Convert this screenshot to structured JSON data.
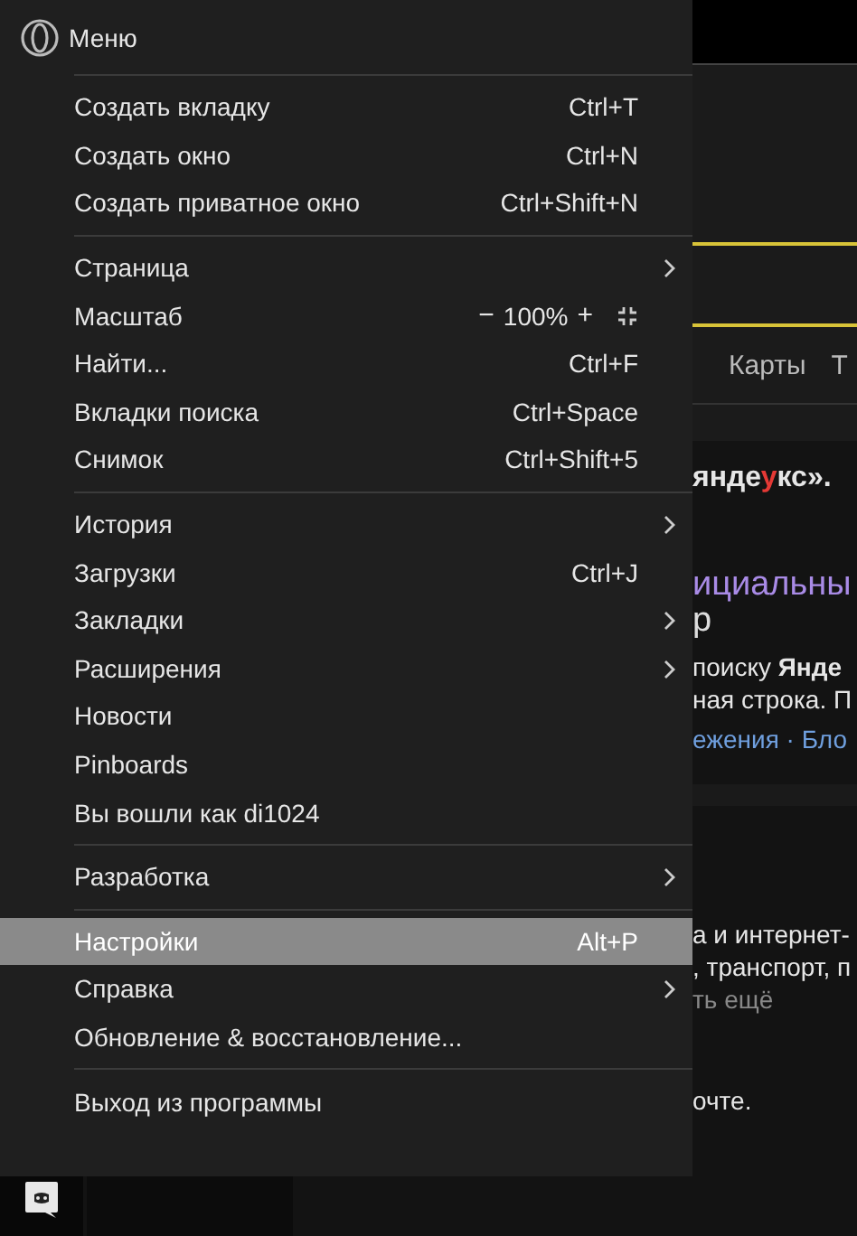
{
  "menu": {
    "title": "Меню",
    "groups": [
      [
        {
          "kind": "item",
          "label": "Создать вкладку",
          "shortcut": "Ctrl+T",
          "submenu": false,
          "selected": false
        },
        {
          "kind": "item",
          "label": "Создать окно",
          "shortcut": "Ctrl+N",
          "submenu": false,
          "selected": false
        },
        {
          "kind": "item",
          "label": "Создать приватное окно",
          "shortcut": "Ctrl+Shift+N",
          "submenu": false,
          "selected": false
        }
      ],
      [
        {
          "kind": "item",
          "label": "Страница",
          "submenu": true,
          "selected": false
        },
        {
          "kind": "zoom",
          "label": "Масштаб",
          "minus": "−",
          "value": "100%",
          "plus": "+",
          "submenu": false,
          "selected": false
        },
        {
          "kind": "item",
          "label": "Найти...",
          "shortcut": "Ctrl+F",
          "submenu": false,
          "selected": false
        },
        {
          "kind": "item",
          "label": "Вкладки поиска",
          "shortcut": "Ctrl+Space",
          "submenu": false,
          "selected": false
        },
        {
          "kind": "item",
          "label": "Снимок",
          "shortcut": "Ctrl+Shift+5",
          "submenu": false,
          "selected": false
        }
      ],
      [
        {
          "kind": "item",
          "label": "История",
          "submenu": true,
          "selected": false
        },
        {
          "kind": "item",
          "label": "Загрузки",
          "shortcut": "Ctrl+J",
          "submenu": false,
          "selected": false
        },
        {
          "kind": "item",
          "label": "Закладки",
          "submenu": true,
          "selected": false
        },
        {
          "kind": "item",
          "label": "Расширения",
          "submenu": true,
          "selected": false
        },
        {
          "kind": "item",
          "label": "Новости",
          "submenu": false,
          "selected": false
        },
        {
          "kind": "item",
          "label": "Pinboards",
          "submenu": false,
          "selected": false
        },
        {
          "kind": "item",
          "label": "Вы вошли как di1024",
          "submenu": false,
          "selected": false
        }
      ],
      [
        {
          "kind": "item",
          "label": "Разработка",
          "submenu": true,
          "selected": false
        }
      ],
      [
        {
          "kind": "item",
          "label": "Настройки",
          "shortcut": "Alt+P",
          "submenu": false,
          "selected": true
        },
        {
          "kind": "item",
          "label": "Справка",
          "submenu": true,
          "selected": false
        },
        {
          "kind": "item",
          "label": "Обновление & восстановление...",
          "submenu": false,
          "selected": false
        }
      ],
      [
        {
          "kind": "item",
          "label": "Выход из программы",
          "submenu": false,
          "selected": false
        }
      ]
    ]
  },
  "page": {
    "tabs": [
      "Карты",
      "Т"
    ],
    "heading_parts": [
      {
        "text": "янде",
        "accent": false
      },
      {
        "text": "у",
        "accent": true
      },
      {
        "text": "кс».",
        "accent": false
      }
    ],
    "result_title": [
      "ициальны",
      "р"
    ],
    "snippet": [
      "поиску **Янде**",
      "ная строка. П"
    ],
    "links": "ежения · Бло",
    "snippet2": [
      "а и интернет-",
      ", транспорт, п"
    ],
    "more": "ть ещё",
    "footer": "очте."
  }
}
